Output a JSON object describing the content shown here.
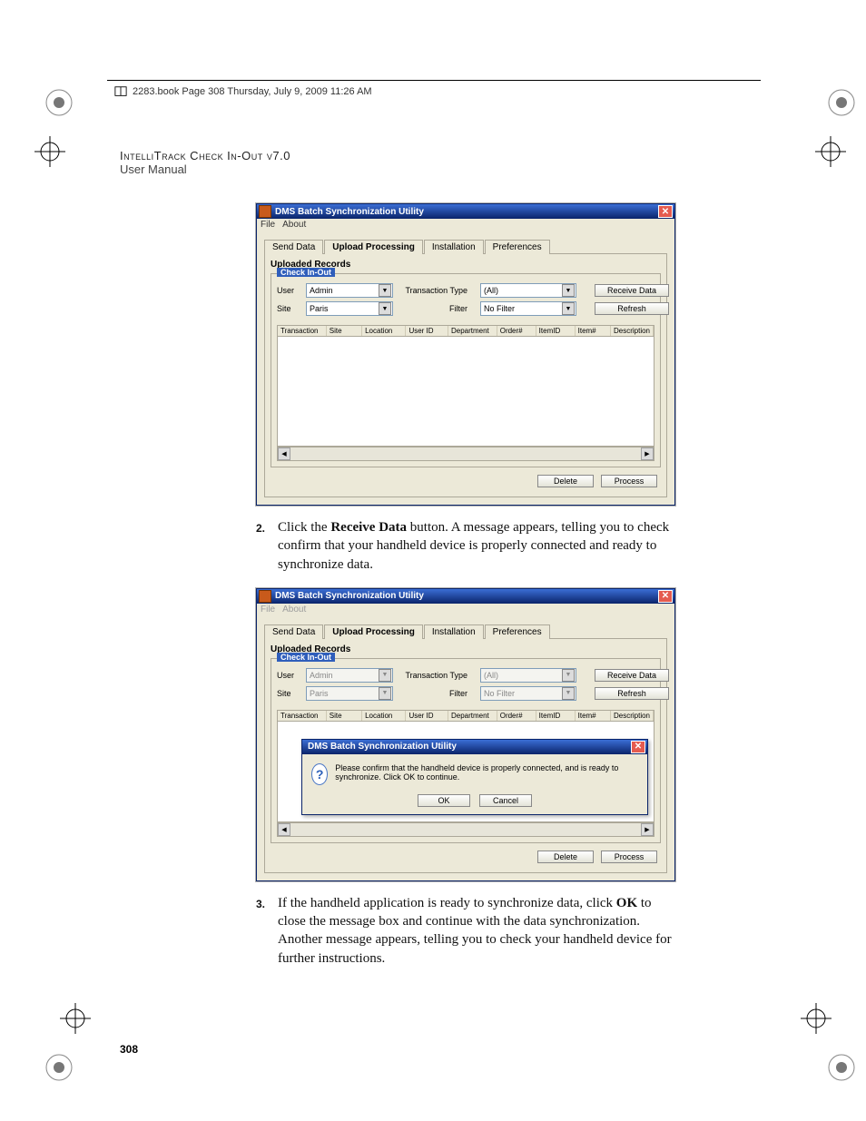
{
  "running_head": {
    "text": "2283.book  Page 308  Thursday, July 9, 2009  11:26 AM"
  },
  "header": {
    "product": "IntelliTrack Check In-Out v7.0",
    "subtitle": "User Manual"
  },
  "page_number": "308",
  "shot1": {
    "title": "DMS Batch Synchronization Utility",
    "menu": {
      "file": "File",
      "about": "About"
    },
    "tabs": [
      "Send Data",
      "Upload Processing",
      "Installation",
      "Preferences"
    ],
    "section": "Uploaded Records",
    "group": "Check In-Out",
    "labels": {
      "user": "User",
      "site": "Site",
      "trantype": "Transaction Type",
      "filter": "Filter"
    },
    "values": {
      "user": "Admin",
      "site": "Paris",
      "trantype": "(All)",
      "filter": "No Filter"
    },
    "buttons": {
      "receive": "Receive Data",
      "refresh": "Refresh",
      "delete": "Delete",
      "process": "Process"
    },
    "columns": [
      "Transaction",
      "Site",
      "Location",
      "User ID",
      "Department",
      "Order#",
      "ItemID",
      "Item#",
      "Description"
    ]
  },
  "step2": {
    "num": "2.",
    "text_a": "Click the ",
    "bold": "Receive Data",
    "text_b": " button. A message appears, telling you to check confirm that your handheld device is properly connected and ready to synchronize data."
  },
  "shot2": {
    "title": "DMS Batch Synchronization Utility",
    "menu": {
      "file": "File",
      "about": "About"
    },
    "tabs": [
      "Send Data",
      "Upload Processing",
      "Installation",
      "Preferences"
    ],
    "section": "Uploaded Records",
    "group": "Check In-Out",
    "labels": {
      "user": "User",
      "site": "Site",
      "trantype": "Transaction Type",
      "filter": "Filter"
    },
    "values": {
      "user": "Admin",
      "site": "Paris",
      "trantype": "(All)",
      "filter": "No Filter"
    },
    "buttons": {
      "receive": "Receive Data",
      "refresh": "Refresh",
      "delete": "Delete",
      "process": "Process"
    },
    "columns": [
      "Transaction",
      "Site",
      "Location",
      "User ID",
      "Department",
      "Order#",
      "ItemID",
      "Item#",
      "Description"
    ],
    "modal": {
      "title": "DMS Batch Synchronization Utility",
      "message": "Please confirm that the handheld device is properly connected, and is ready to synchronize. Click OK to continue.",
      "ok": "OK",
      "cancel": "Cancel"
    }
  },
  "step3": {
    "num": "3.",
    "text_a": "If the handheld application is ready to synchronize data, click ",
    "bold": "OK",
    "text_b": " to close the message box and continue with the data synchronization. Another message appears, telling you to check your handheld device for further instructions."
  }
}
